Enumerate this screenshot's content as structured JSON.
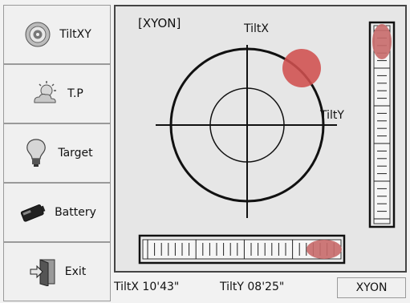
{
  "sidebar": {
    "items": [
      {
        "label": "TiltXY",
        "icon": "target-rings-icon"
      },
      {
        "label": "T.P",
        "icon": "sun-cloud-icon"
      },
      {
        "label": "Target",
        "icon": "light-bulb-icon"
      },
      {
        "label": "Battery",
        "icon": "battery-icon"
      },
      {
        "label": "Exit",
        "icon": "exit-door-icon"
      }
    ]
  },
  "display": {
    "mode_tag": "[XYON]",
    "tilt_x_axis_label": "TiltX",
    "tilt_y_axis_label": "TiltY"
  },
  "status": {
    "tilt_x": "TiltX 10'43\"",
    "tilt_y": "TiltY 08'25\"",
    "mode_button": "XYON"
  },
  "colors": {
    "bubble": "#d0504f",
    "panel_bg": "#e6e6e6",
    "lines": "#111111"
  }
}
